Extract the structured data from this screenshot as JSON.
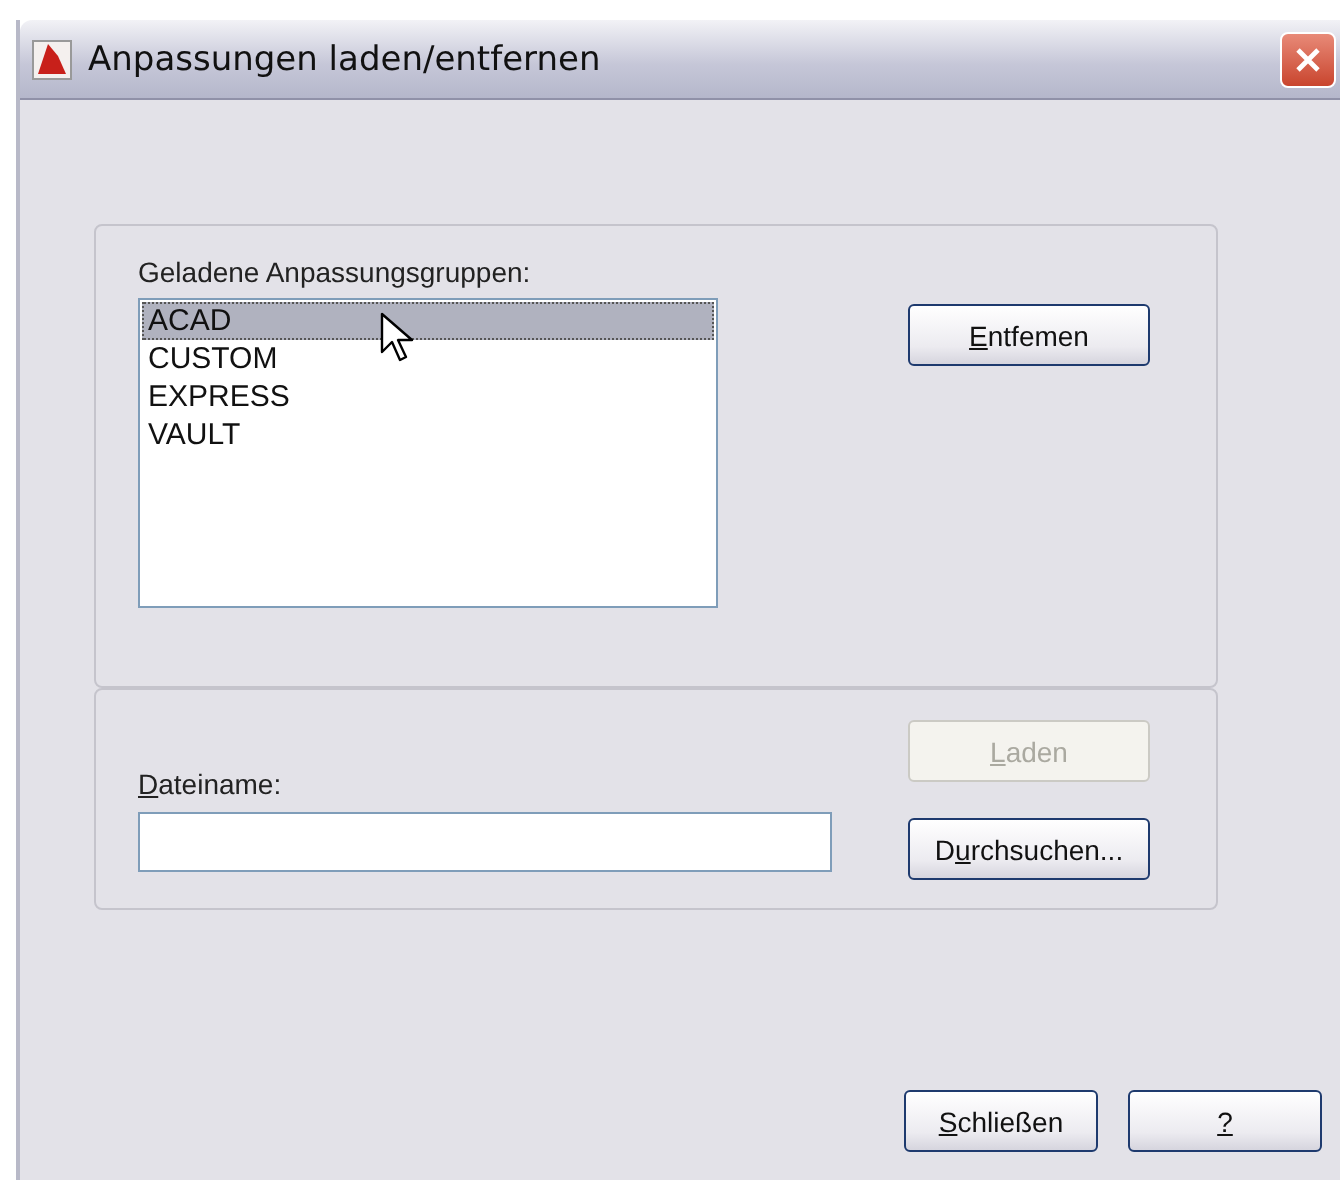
{
  "window": {
    "title": "Anpassungen laden/entfernen"
  },
  "loaded_groups": {
    "label": "Geladene Anpassungsgruppen:",
    "items": [
      {
        "name": "ACAD",
        "selected": true
      },
      {
        "name": "CUSTOM",
        "selected": false
      },
      {
        "name": "EXPRESS",
        "selected": false
      },
      {
        "name": "VAULT",
        "selected": false
      }
    ],
    "remove_button": {
      "key": "E",
      "after": "ntfemen",
      "disabled": false
    }
  },
  "load": {
    "load_button": {
      "key": "L",
      "after": "aden",
      "disabled": true
    },
    "file_label": {
      "key": "D",
      "after": "ateiname:"
    },
    "browse_button": {
      "before": "D",
      "key": "u",
      "after": "rchsuchen...",
      "disabled": false
    }
  },
  "footer_buttons": [
    {
      "key": "S",
      "after": "chließen",
      "disabled": false
    },
    {
      "key": "?",
      "disabled": false
    }
  ]
}
